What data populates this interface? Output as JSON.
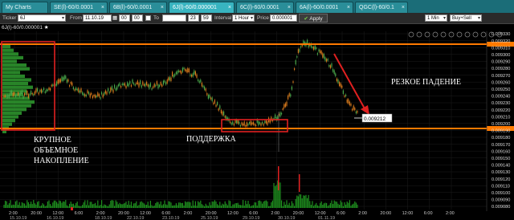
{
  "tabs": [
    {
      "label": "My Charts",
      "close": "×"
    },
    {
      "label": "SE(l)-60/0.0001",
      "close": "×"
    },
    {
      "label": "6B(l)-60/0.0001",
      "close": "×"
    },
    {
      "label": "6J(l)-60/0.000001",
      "close": "×"
    },
    {
      "label": "6C(l)-60/0.0001",
      "close": "×"
    },
    {
      "label": "6A(l)-60/0.0001",
      "close": "×"
    },
    {
      "label": "QGC(l)-60/0.1",
      "close": "×"
    }
  ],
  "toolbar": {
    "ticker_label": "Ticker",
    "ticker_value": "6J",
    "from_label": "From",
    "from_date": "11.10.19",
    "from_hour": "00",
    "from_min": "00",
    "to_label": "To",
    "to_hour": "23",
    "to_min": "59",
    "interval_label": "Interval",
    "interval_value": "1 Hour",
    "price_scale_label": "Price scale",
    "price_scale_value": "0.000001",
    "apply_label": "Apply",
    "timeframe_value": "1 Min",
    "trade_type_value": "Buy+Sell"
  },
  "symbol_title": "6J(l)-60/0.000001",
  "price_axis": [
    "0.009330",
    "0.009320",
    "0.009310",
    "0.009300",
    "0.009290",
    "0.009280",
    "0.009270",
    "0.009260",
    "0.009250",
    "0.009240",
    "0.009230",
    "0.009220",
    "0.009210",
    "0.009200",
    "0.009190",
    "0.009180",
    "0.009170",
    "0.009160",
    "0.009150",
    "0.009140",
    "0.009130",
    "0.009120",
    "0.009110",
    "0.009100",
    "0.009090",
    "0.009080"
  ],
  "time_axis": [
    "2:00",
    "20:00",
    "12:00",
    "6:00",
    "2:00",
    "20:00",
    "12:00",
    "6:00",
    "2:00",
    "20:00",
    "12:00",
    "6:00",
    "2:00",
    "20:00",
    "12:00",
    "6:00",
    "2:00",
    "20:00",
    "12:00",
    "6:00",
    "2:00"
  ],
  "date_axis": [
    "15.10.19",
    "16.10.19",
    "18.10.19",
    "22.10.19",
    "23.10.19",
    "25.10.19",
    "29.10.19",
    "30.10.19",
    "01.11.19"
  ],
  "current_price": "0.009212",
  "annotations": {
    "accumulation": [
      "КРУПНОЕ",
      "ОБЪЕМНОЕ",
      "НАКОПЛЕНИЕ"
    ],
    "support": "ПОДДЕРЖКА",
    "sharp_drop": "РЕЗКОЕ ПАДЕНИЕ"
  },
  "colors": {
    "tab_bar": "#1b6d78",
    "level_line": "#ff7a00",
    "highlight_box": "#e02020",
    "arrow": "#e02020",
    "profile": "#2f9b2f",
    "volume": "#1e8f1e",
    "candle_up": "#d97a1c",
    "candle_down": "#4aa84a"
  }
}
